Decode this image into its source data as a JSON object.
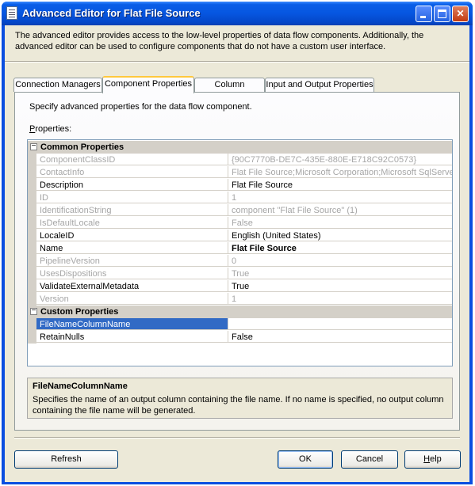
{
  "window": {
    "title": "Advanced Editor for Flat File Source",
    "intro": "The advanced editor provides access to the low-level properties of data flow components. Additionally, the advanced editor can be used to configure components that do not have a custom user interface."
  },
  "tabs": [
    {
      "label": "Connection Managers",
      "active": false
    },
    {
      "label": "Component Properties",
      "active": true
    },
    {
      "label": "Column Mappings",
      "active": false
    },
    {
      "label": "Input and Output Properties",
      "active": false
    }
  ],
  "panel": {
    "description": "Specify advanced properties for the data flow component.",
    "properties_label_accel": "P",
    "properties_label_rest": "roperties:"
  },
  "property_grid": {
    "categories": [
      {
        "label": "Common Properties",
        "expander": "−",
        "rows": [
          {
            "name": "ComponentClassID",
            "value": "{90C7770B-DE7C-435E-880E-E718C92C0573}",
            "readonly": true
          },
          {
            "name": "ContactInfo",
            "value": "Flat File Source;Microsoft Corporation;Microsoft SqlServer v",
            "readonly": true
          },
          {
            "name": "Description",
            "value": "Flat File Source",
            "readonly": false
          },
          {
            "name": "ID",
            "value": "1",
            "readonly": true
          },
          {
            "name": "IdentificationString",
            "value": "component \"Flat File Source\" (1)",
            "readonly": true
          },
          {
            "name": "IsDefaultLocale",
            "value": "False",
            "readonly": true
          },
          {
            "name": "LocaleID",
            "value": "English (United States)",
            "readonly": false
          },
          {
            "name": "Name",
            "value": "Flat File Source",
            "readonly": false,
            "bold": true
          },
          {
            "name": "PipelineVersion",
            "value": "0",
            "readonly": true
          },
          {
            "name": "UsesDispositions",
            "value": "True",
            "readonly": true
          },
          {
            "name": "ValidateExternalMetadata",
            "value": "True",
            "readonly": false
          },
          {
            "name": "Version",
            "value": "1",
            "readonly": true
          }
        ]
      },
      {
        "label": "Custom Properties",
        "expander": "−",
        "rows": [
          {
            "name": "FileNameColumnName",
            "value": "",
            "readonly": false,
            "selected": true
          },
          {
            "name": "RetainNulls",
            "value": "False",
            "readonly": false
          }
        ]
      }
    ]
  },
  "help": {
    "title": "FileNameColumnName",
    "text": "Specifies the name of an output column containing the file name. If no name is specified, no output column containing the file name will be generated."
  },
  "buttons": {
    "refresh": "Refresh",
    "ok": "OK",
    "cancel": "Cancel",
    "help_accel": "H",
    "help_rest": "elp"
  },
  "colors": {
    "titlebar": "#0656e0",
    "dialog_bg": "#ece9d8",
    "selection": "#316ac5",
    "readonly_text": "#a6a6a6"
  }
}
